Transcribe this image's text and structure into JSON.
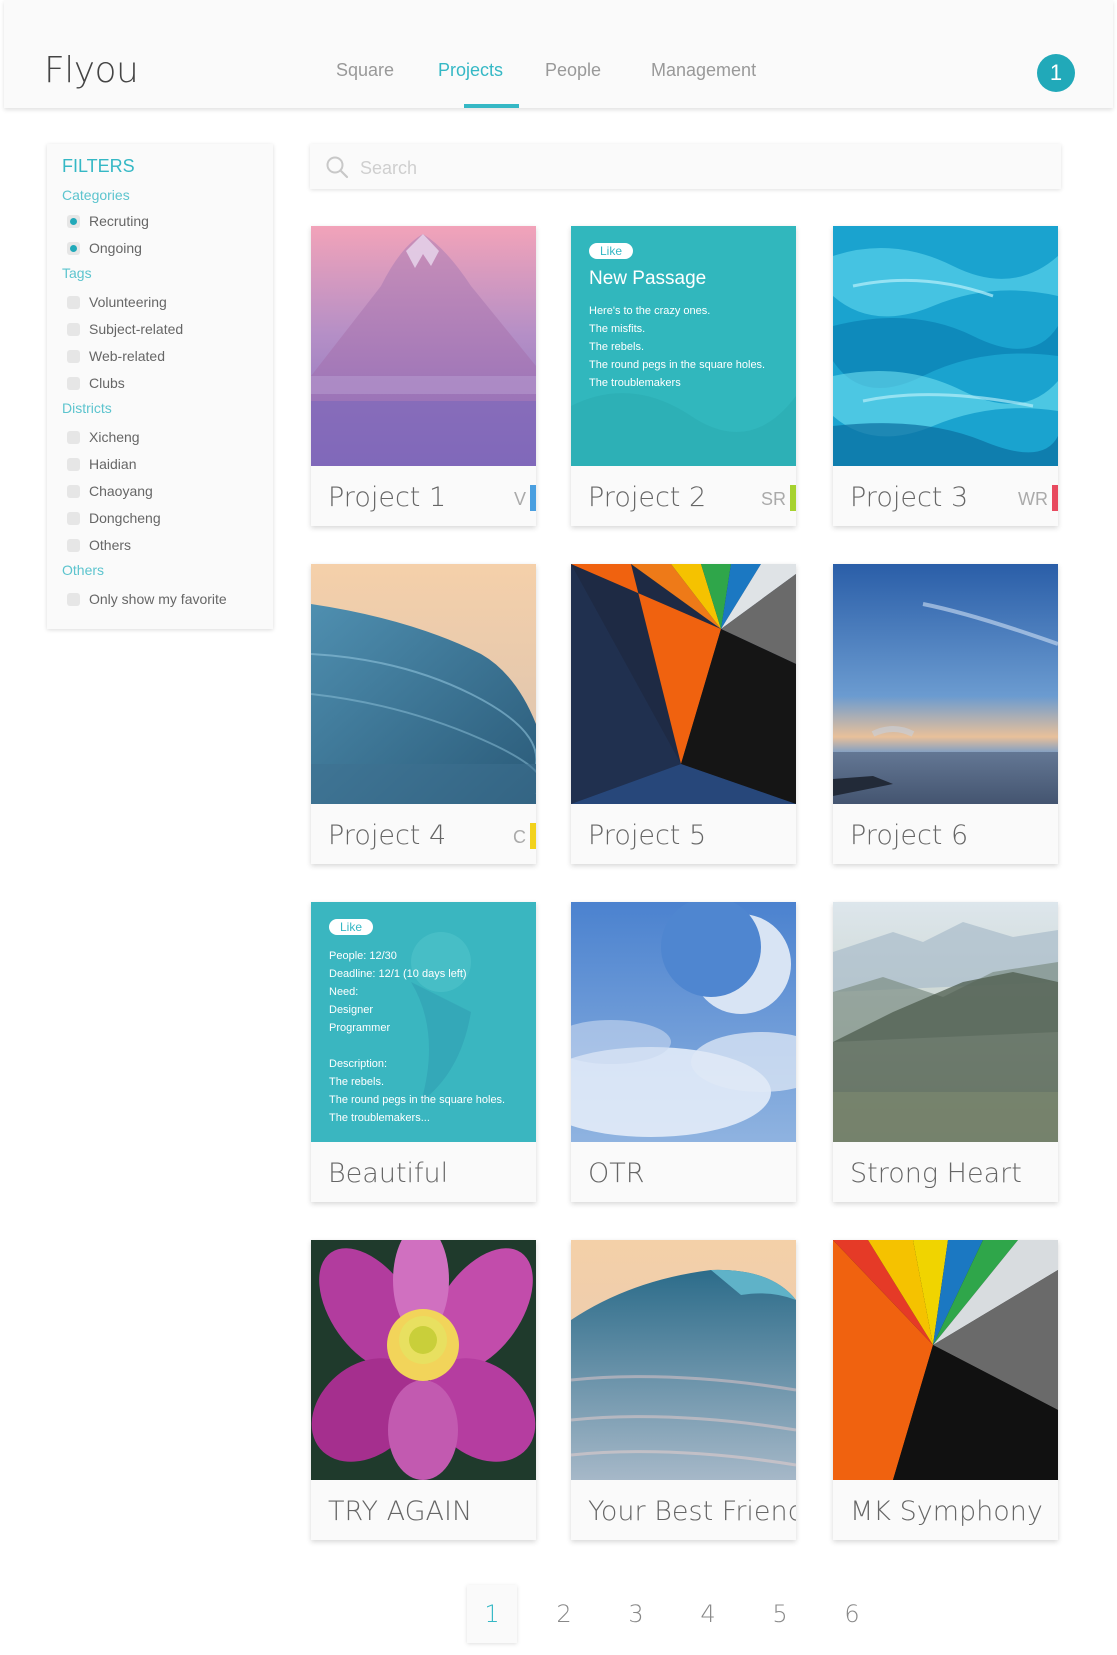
{
  "app": {
    "logo": "Flyou",
    "notification_count": "1"
  },
  "nav": {
    "items": [
      {
        "label": "Square"
      },
      {
        "label": "Projects"
      },
      {
        "label": "People"
      },
      {
        "label": "Management"
      }
    ],
    "active": "Projects"
  },
  "filters": {
    "title": "FILTERS",
    "categories_label": "Categories",
    "categories": [
      {
        "label": "Recruting",
        "checked": true
      },
      {
        "label": "Ongoing",
        "checked": true
      }
    ],
    "tags_label": "Tags",
    "tags": [
      {
        "label": "Volunteering"
      },
      {
        "label": "Subject-related"
      },
      {
        "label": "Web-related"
      },
      {
        "label": "Clubs"
      }
    ],
    "districts_label": "Districts",
    "districts": [
      {
        "label": "Xicheng"
      },
      {
        "label": "Haidian"
      },
      {
        "label": "Chaoyang"
      },
      {
        "label": "Dongcheng"
      },
      {
        "label": "Others"
      }
    ],
    "others_label": "Others",
    "others": [
      {
        "label": "Only show my favorite"
      }
    ]
  },
  "search": {
    "placeholder": "Search"
  },
  "cards": [
    {
      "title": "Project 1",
      "tag": "V",
      "tag_color": "#4a9fe0",
      "image": "mountain-image"
    },
    {
      "title": "Project 2",
      "tag": "SR",
      "tag_color": "#a6d22e",
      "image": "teal-text-panel",
      "like": "Like",
      "heading": "New Passage",
      "lines": [
        "Here's to the crazy ones.",
        "The misfits.",
        "The rebels.",
        "The round pegs in the square holes.",
        "The troublemakers"
      ]
    },
    {
      "title": "Project 3",
      "tag": "WR",
      "tag_color": "#e84a5f",
      "image": "blue-waves-image"
    },
    {
      "title": "Project 4",
      "tag": "C",
      "tag_color": "#f2d21c",
      "image": "wave-image"
    },
    {
      "title": "Project 5",
      "image": "color-rays-image"
    },
    {
      "title": "Project 6",
      "image": "sky-sea-image"
    },
    {
      "title": "Beautiful",
      "image": "teal-info-panel",
      "like": "Like",
      "lines": [
        "People: 12/30",
        "Deadline: 12/1 (10 days left)",
        "Need:",
        "Designer",
        "Programmer",
        "",
        "Description:",
        "The rebels.",
        "The round pegs in the square holes.",
        "The troublemakers..."
      ]
    },
    {
      "title": "OTR",
      "image": "moon-sky-image"
    },
    {
      "title": "Strong Heart",
      "image": "misty-mountains-image"
    },
    {
      "title": "TRY AGAIN",
      "image": "lotus-image"
    },
    {
      "title": "Your Best Friend",
      "image": "wave-image"
    },
    {
      "title": "MK Symphony",
      "image": "color-rays-image"
    }
  ],
  "pagination": {
    "pages": [
      "1",
      "2",
      "3",
      "4",
      "5",
      "6"
    ],
    "active": "1"
  }
}
